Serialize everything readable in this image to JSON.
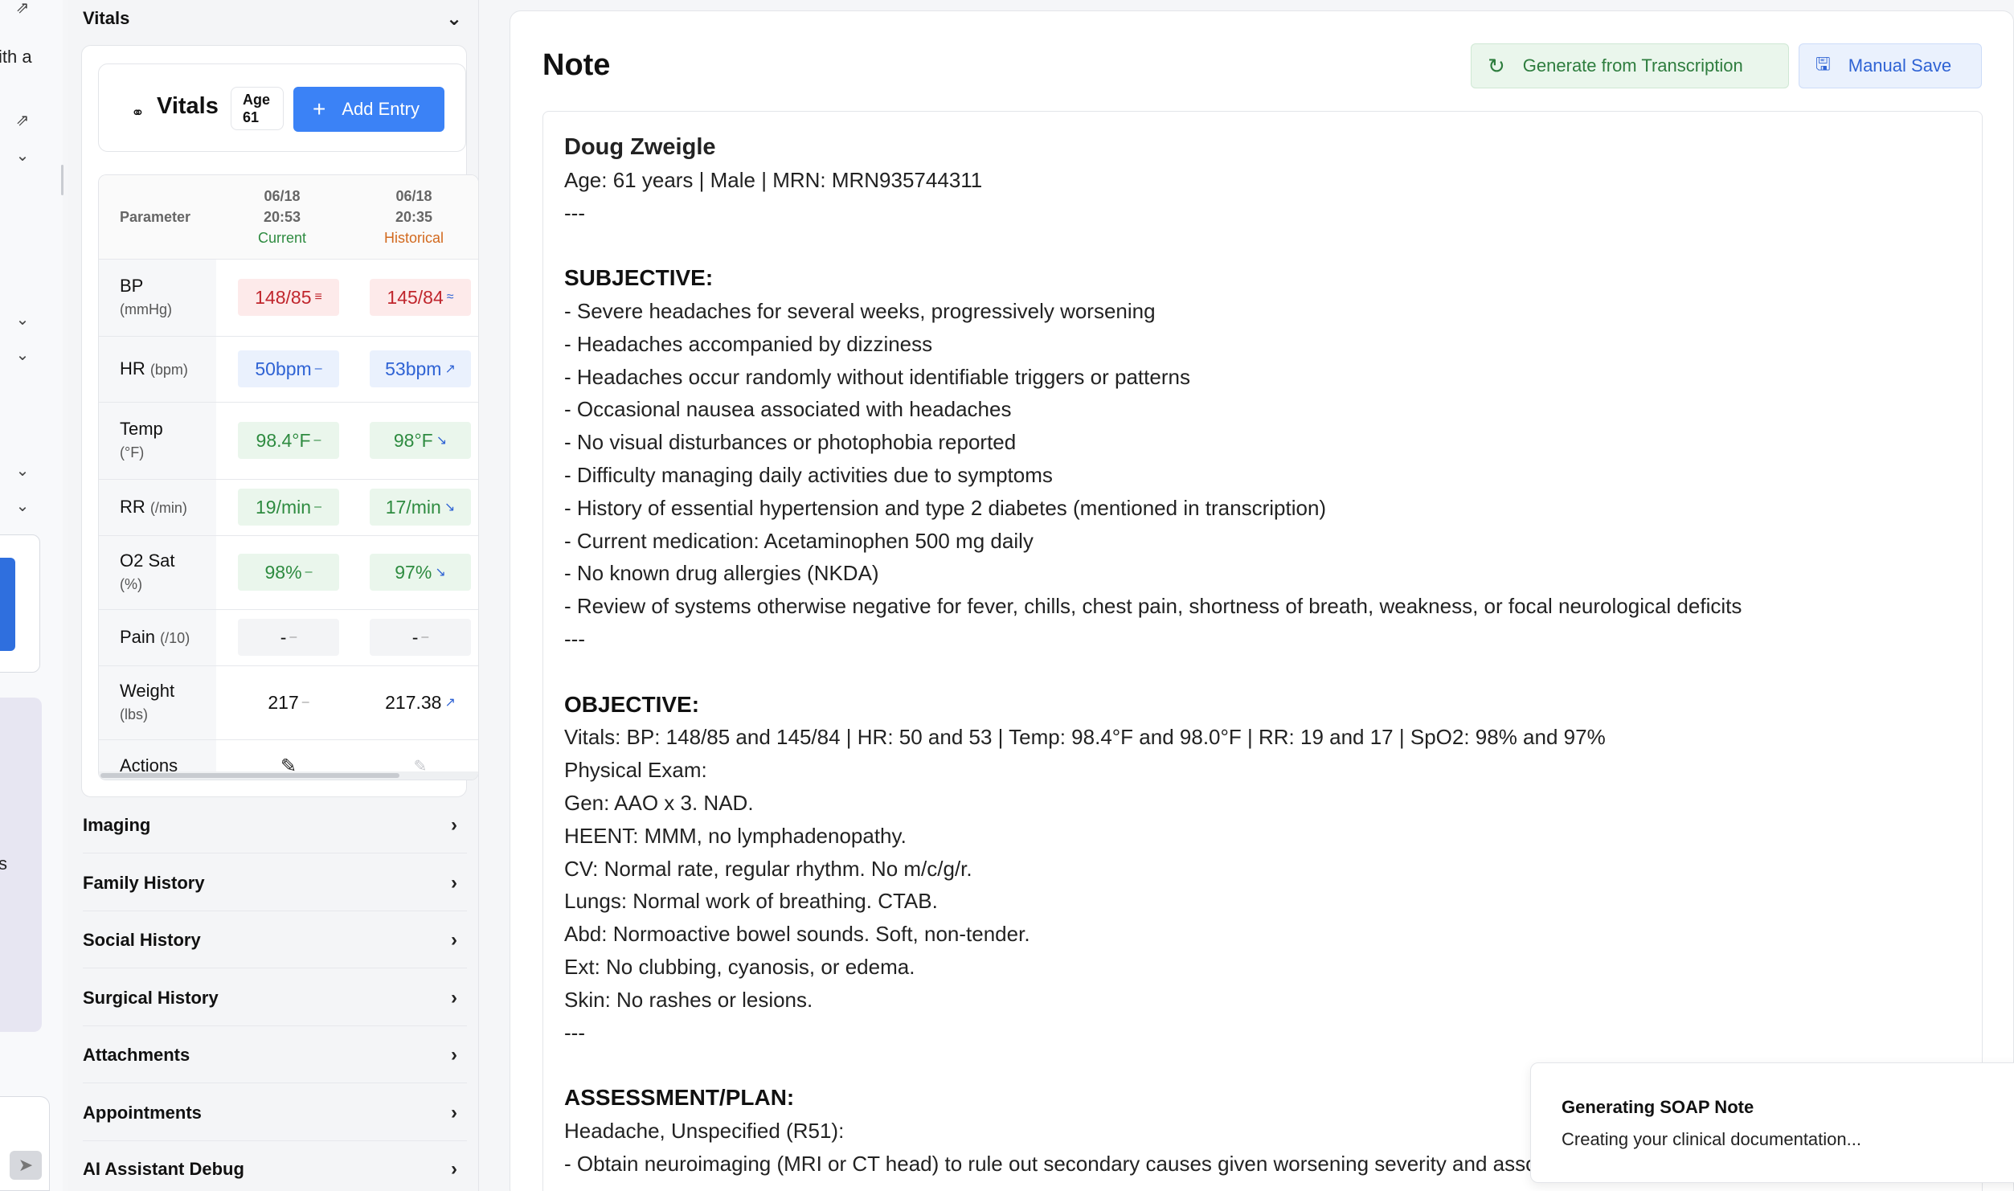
{
  "left_strip": {
    "fragment_top": "ith a",
    "fragment_mid": "s"
  },
  "sidebar": {
    "vitals_section": {
      "label": "Vitals"
    },
    "vitals_card": {
      "title": "Vitals",
      "age_label": "Age",
      "age_value": "61",
      "add_button": "Add Entry"
    },
    "vitals_table": {
      "header_param": "Parameter",
      "columns": [
        {
          "date": "06/18",
          "time": "20:53",
          "status": "Current"
        },
        {
          "date": "06/18",
          "time": "20:35",
          "status": "Historical"
        }
      ],
      "rows": [
        {
          "name": "BP",
          "unit": "(mmHg)",
          "values": [
            "148/85",
            "145/84"
          ]
        },
        {
          "name": "HR",
          "unit": "(bpm)",
          "values": [
            "50bpm",
            "53bpm"
          ]
        },
        {
          "name": "Temp",
          "unit": "(°F)",
          "values": [
            "98.4°F",
            "98°F"
          ]
        },
        {
          "name": "RR",
          "unit": "(/min)",
          "values": [
            "19/min",
            "17/min"
          ]
        },
        {
          "name": "O2 Sat",
          "unit": "(%)",
          "values": [
            "98%",
            "97%"
          ]
        },
        {
          "name": "Pain",
          "unit": "(/10)",
          "values": [
            "-",
            "-"
          ]
        },
        {
          "name": "Weight",
          "unit": "(lbs)",
          "values": [
            "217",
            "217.38"
          ]
        }
      ],
      "actions_label": "Actions"
    },
    "sections": [
      {
        "label": "Imaging"
      },
      {
        "label": "Family History"
      },
      {
        "label": "Social History"
      },
      {
        "label": "Surgical History"
      },
      {
        "label": "Attachments"
      },
      {
        "label": "Appointments"
      },
      {
        "label": "AI Assistant Debug"
      }
    ]
  },
  "note": {
    "title": "Note",
    "generate_button": "Generate from Transcription",
    "save_button": "Manual Save",
    "patient_name": "Doug Zweigle",
    "demographics": "Age: 61 years | Male | MRN: MRN935744311",
    "separator": "---",
    "subjective_heading": "SUBJECTIVE:",
    "subjective": [
      "- Severe headaches for several weeks, progressively worsening",
      "- Headaches accompanied by dizziness",
      "- Headaches occur randomly without identifiable triggers or patterns",
      "- Occasional nausea associated with headaches",
      "- No visual disturbances or photophobia reported",
      "- Difficulty managing daily activities due to symptoms",
      "- History of essential hypertension and type 2 diabetes (mentioned in transcription)",
      "- Current medication: Acetaminophen 500 mg daily",
      "- No known drug allergies (NKDA)",
      "- Review of systems otherwise negative for fever, chills, chest pain, shortness of breath, weakness, or focal neurological deficits"
    ],
    "objective_heading": "OBJECTIVE:",
    "objective": [
      "Vitals: BP: 148/85 and 145/84 | HR: 50 and 53 | Temp: 98.4°F and 98.0°F | RR: 19 and 17 | SpO2: 98% and 97%",
      "Physical Exam:",
      "Gen: AAO x 3. NAD.",
      "HEENT: MMM, no lymphadenopathy.",
      "CV: Normal rate, regular rhythm. No m/c/g/r.",
      "Lungs: Normal work of breathing. CTAB.",
      "Abd: Normoactive bowel sounds. Soft, non-tender.",
      "Ext: No clubbing, cyanosis, or edema.",
      "Skin: No rashes or lesions."
    ],
    "assessment_heading": "ASSESSMENT/PLAN:",
    "assessment": [
      "Headache, Unspecified (R51):",
      "- Obtain neuroimaging (MRI or CT head) to rule out secondary causes given worsening severity and associated dizziness"
    ]
  },
  "toast": {
    "title": "Generating SOAP Note",
    "message": "Creating your clinical documentation..."
  },
  "colors": {
    "primary_blue": "#3b82f6",
    "current_green": "#2e8b40",
    "historical_orange": "#d2691e",
    "alert_red": "#c0262d"
  }
}
